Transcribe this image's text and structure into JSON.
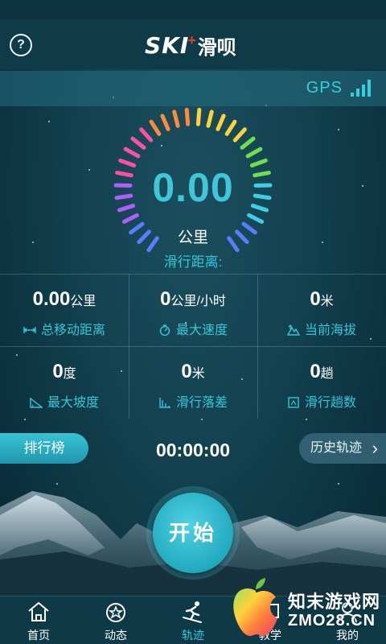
{
  "app": {
    "logo_ski": "SKI",
    "logo_plus": "+",
    "logo_cn": "滑呗",
    "help_icon": "?"
  },
  "gps": {
    "label": "GPS",
    "signal_level": 4
  },
  "gauge": {
    "value": "0.00",
    "unit": "公里",
    "caption": "滑行距离:",
    "tick_colors": [
      "#ff4fa0",
      "#ff8a3c",
      "#ffd23a",
      "#6ee04a",
      "#3ad0e6",
      "#5a7cff",
      "#b05cff"
    ]
  },
  "stats": [
    {
      "num": "0.00",
      "unit": "公里",
      "label": "总移动距离",
      "icon": "distance-icon"
    },
    {
      "num": "0",
      "unit": "公里/小时",
      "label": "最大速度",
      "icon": "speed-icon"
    },
    {
      "num": "0",
      "unit": "米",
      "label": "当前海拔",
      "icon": "altitude-icon"
    },
    {
      "num": "0",
      "unit": "度",
      "label": "最大坡度",
      "icon": "slope-icon"
    },
    {
      "num": "0",
      "unit": "米",
      "label": "滑行落差",
      "icon": "drop-icon"
    },
    {
      "num": "0",
      "unit": "趟",
      "label": "滑行趟数",
      "icon": "runs-icon"
    }
  ],
  "controls": {
    "rank_label": "排行榜",
    "timer": "00:00:00",
    "history_label": "历史轨迹",
    "start_label": "开始"
  },
  "tabs": [
    {
      "label": "首页",
      "icon": "home-icon"
    },
    {
      "label": "动态",
      "icon": "feed-icon"
    },
    {
      "label": "轨迹",
      "icon": "skier-icon",
      "active": true
    },
    {
      "label": "教学",
      "icon": "teach-icon"
    },
    {
      "label": "我的",
      "icon": "profile-icon"
    }
  ],
  "watermark": {
    "line1": "知末游戏网",
    "line2": "ZMO28.CN"
  },
  "colors": {
    "accent": "#35c6d8",
    "background": "#12404e",
    "tabbar": "#0e3a48"
  }
}
